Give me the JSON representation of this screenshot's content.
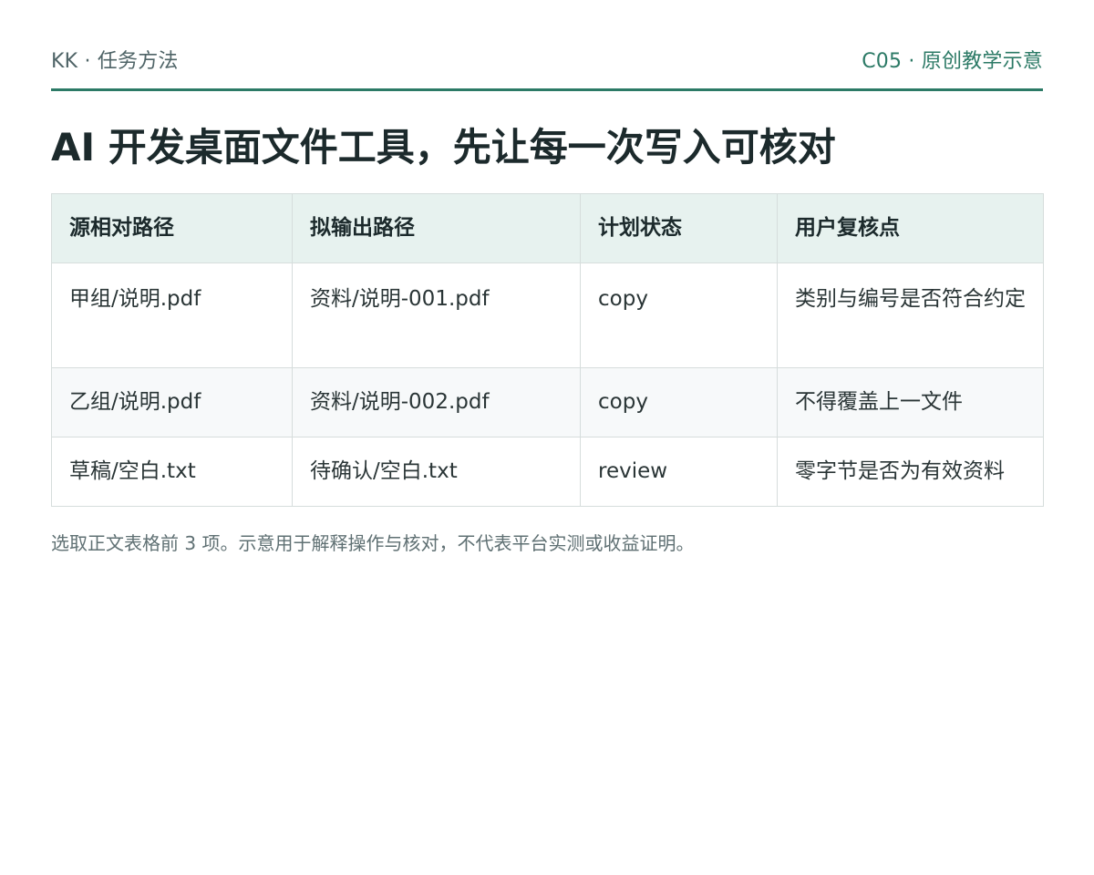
{
  "header": {
    "left": "KK · 任务方法",
    "right": "C05 · 原创教学示意"
  },
  "title": "AI 开发桌面文件工具，先让每一次写入可核对",
  "table": {
    "columns": [
      "源相对路径",
      "拟输出路径",
      "计划状态",
      "用户复核点"
    ],
    "rows": [
      [
        "甲组/说明.pdf",
        "资料/说明-001.pdf",
        "copy",
        "类别与编号是否符合约定"
      ],
      [
        "乙组/说明.pdf",
        "资料/说明-002.pdf",
        "copy",
        "不得覆盖上一文件"
      ],
      [
        "草稿/空白.txt",
        "待确认/空白.txt",
        "review",
        "零字节是否为有效资料"
      ]
    ]
  },
  "footnote": "选取正文表格前 3 项。示意用于解释操作与核对，不代表平台实测或收益证明。",
  "colors": {
    "accent": "#2c7a66",
    "header_bg": "#e7f2ef"
  }
}
